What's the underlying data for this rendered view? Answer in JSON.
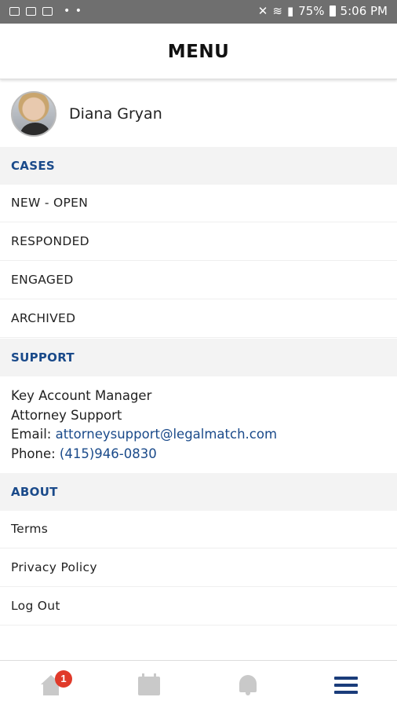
{
  "status_bar": {
    "battery": "75%",
    "time": "5:06 PM"
  },
  "header": {
    "title": "MENU"
  },
  "profile": {
    "name": "Diana Gryan"
  },
  "sections": {
    "cases": {
      "title": "CASES",
      "items": [
        "NEW - OPEN",
        "RESPONDED",
        "ENGAGED",
        "ARCHIVED"
      ]
    },
    "support": {
      "title": "SUPPORT",
      "line1": "Key Account Manager",
      "line2": "Attorney Support",
      "email_label": "Email:",
      "email": "attorneysupport@legalmatch.com",
      "phone_label": "Phone:",
      "phone": "(415)946-0830"
    },
    "about": {
      "title": "ABOUT",
      "items": [
        "Terms",
        "Privacy Policy",
        "Log Out"
      ]
    }
  },
  "bottom_nav": {
    "items": [
      {
        "icon": "home-icon",
        "badge": "1"
      },
      {
        "icon": "calendar-icon"
      },
      {
        "icon": "bell-icon"
      },
      {
        "icon": "menu-icon",
        "active": true
      }
    ],
    "active_color": "#1a3c7a",
    "inactive_color": "#c9c9c9"
  },
  "colors": {
    "accent": "#1a4a8a",
    "badge": "#e03a2a",
    "section_bg": "#f3f3f3"
  }
}
